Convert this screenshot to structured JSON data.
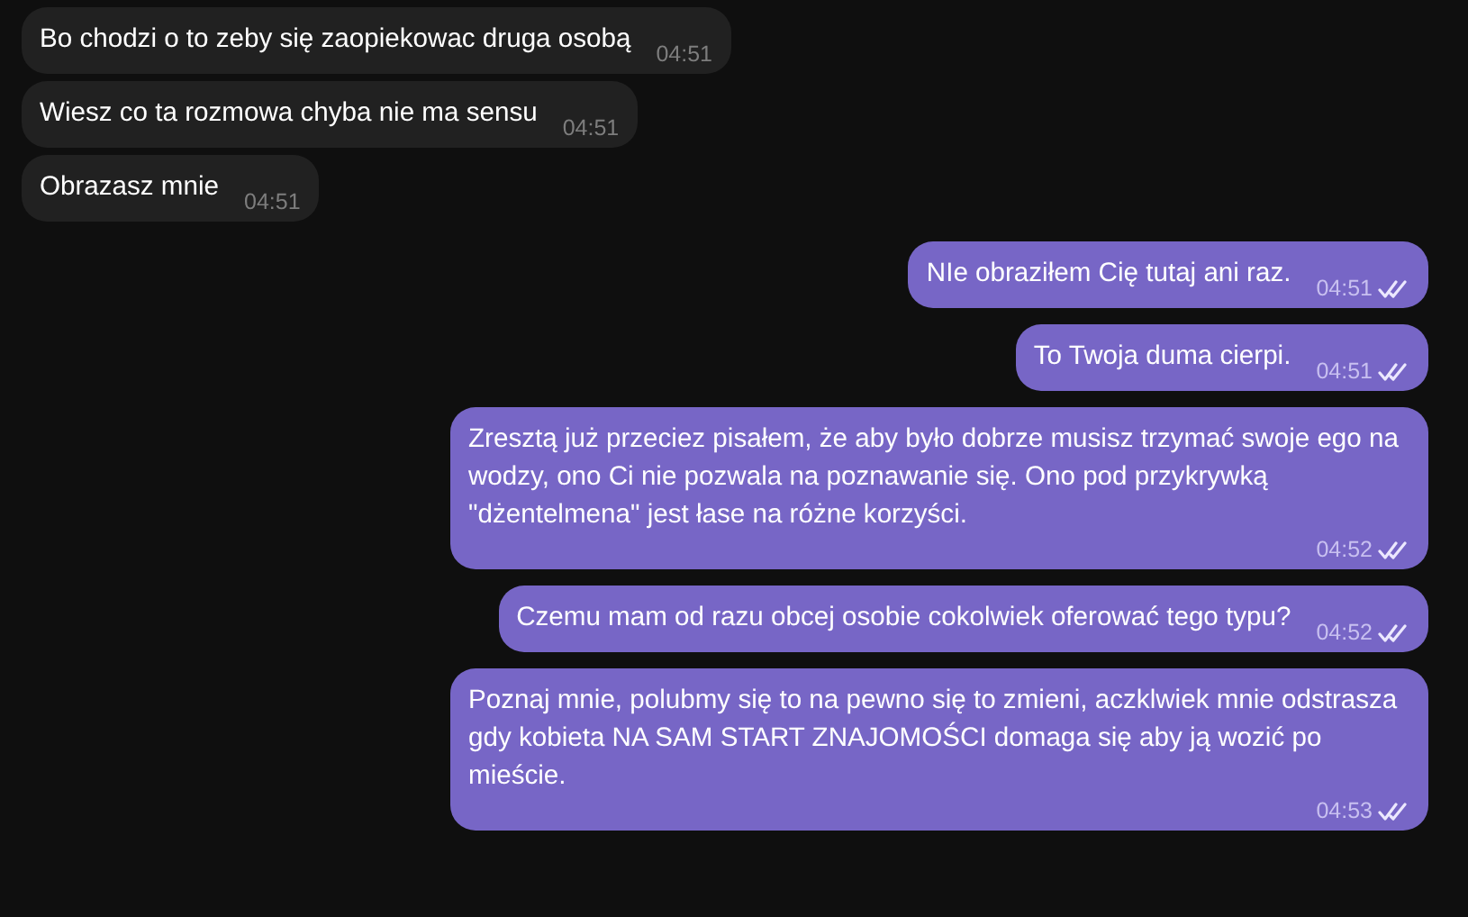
{
  "messages": [
    {
      "kind": "in",
      "text": "Bo chodzi o to zeby się zaopiekowac druga osobą",
      "time": "04:51"
    },
    {
      "kind": "in",
      "text": "Wiesz co ta rozmowa chyba nie ma sensu",
      "time": "04:51"
    },
    {
      "kind": "in",
      "text": "Obrazasz mnie",
      "time": "04:51"
    },
    {
      "kind": "out",
      "text": "NIe obraziłem Cię tutaj ani raz.",
      "time": "04:51",
      "read": true
    },
    {
      "kind": "out",
      "text": "To Twoja duma cierpi.",
      "time": "04:51",
      "read": true
    },
    {
      "kind": "out",
      "text": "Zresztą już przeciez pisałem, że aby było dobrze musisz trzymać swoje ego na wodzy, ono Ci nie pozwala na poznawanie się. Ono pod przykrywką \"dżentelmena\" jest łase na różne korzyści.",
      "time": "04:52",
      "read": true
    },
    {
      "kind": "out",
      "text": "Czemu mam od razu obcej osobie cokolwiek oferować tego typu?",
      "time": "04:52",
      "read": true
    },
    {
      "kind": "out",
      "text": "Poznaj mnie, polubmy się to na pewno się to zmieni, aczklwiek mnie odstrasza gdy kobieta NA SAM START ZNAJOMOŚCI domaga się aby ją wozić po mieście.",
      "time": "04:53",
      "read": true
    }
  ]
}
